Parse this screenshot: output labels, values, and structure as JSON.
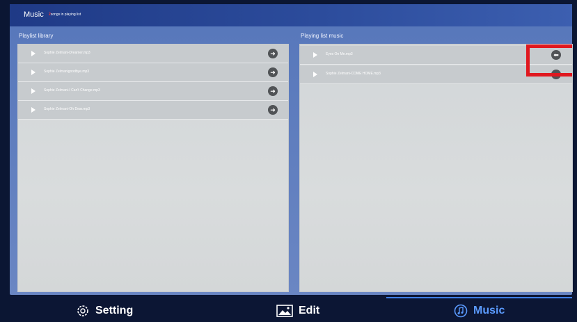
{
  "header": {
    "title": "Music",
    "song_count": "2",
    "song_count_label": "songs in playing list"
  },
  "library": {
    "title": "Playlist library",
    "items": [
      {
        "name": "Sophie Zelmani-Dreamer.mp3"
      },
      {
        "name": "Sophie Zelmanigoodbye.mp3"
      },
      {
        "name": "Sophie Zelmani-I Can't Change.mp3"
      },
      {
        "name": "Sophie Zelmani-Oh Dear.mp3"
      }
    ],
    "action_icon": "arrow-right-circle-icon"
  },
  "playing": {
    "title": "Playing list music",
    "items": [
      {
        "name": "Eyes On Me.mp3"
      },
      {
        "name": "Sophie Zelmani-COME HOME.mp3"
      }
    ],
    "action_icon": "arrow-left-circle-icon"
  },
  "nav": {
    "setting": "Setting",
    "edit": "Edit",
    "music": "Music",
    "active": "Music"
  },
  "colors": {
    "highlight": "#e0181f",
    "active_tab": "#5b9bff"
  }
}
